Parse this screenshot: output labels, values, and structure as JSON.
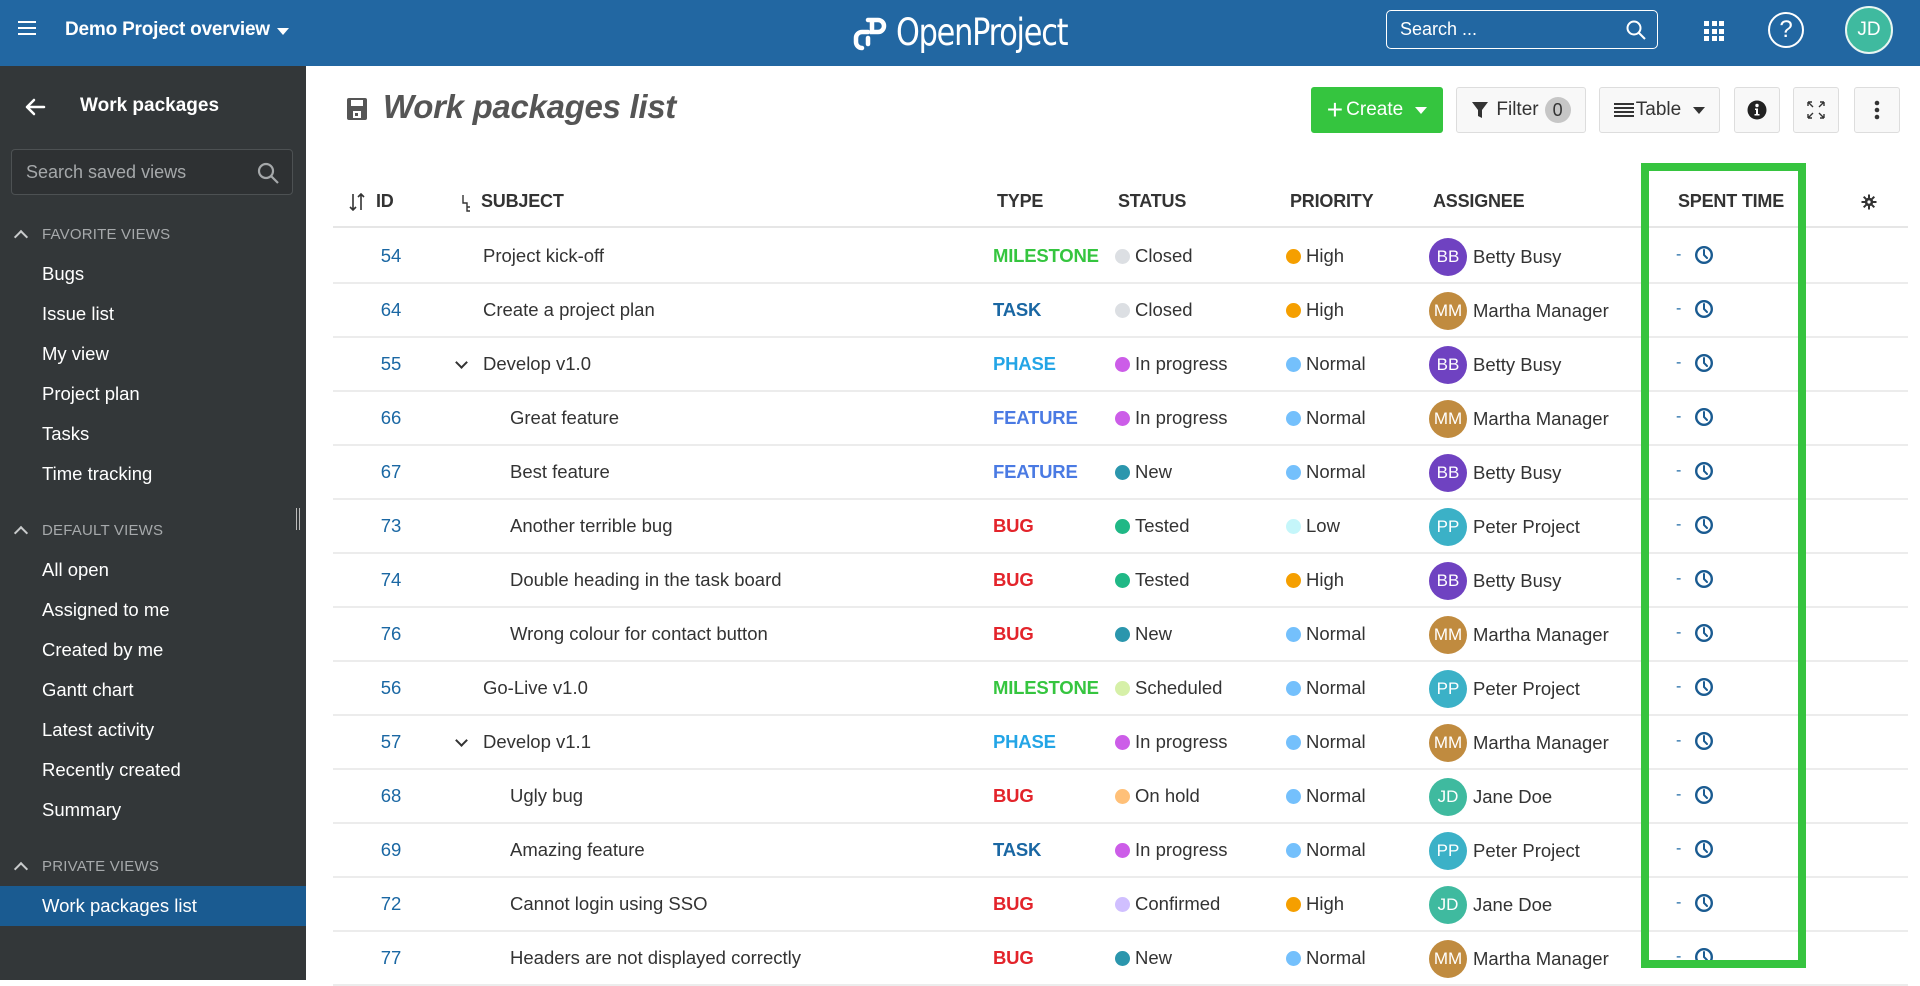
{
  "header": {
    "menu_icon": "hamburger-icon",
    "project_name": "Demo Project overview",
    "logo_text": "OpenProject",
    "search_placeholder": "Search ...",
    "modules_icon": "grid-icon",
    "help_icon_label": "?",
    "user_initials": "JD",
    "user_avatar_color": "#3fba9f",
    "brand_color": "#2267a2"
  },
  "sidebar": {
    "back_icon": "arrow-left-icon",
    "title": "Work packages",
    "search_placeholder": "Search saved views",
    "sections": [
      {
        "label": "FAVORITE VIEWS",
        "items": [
          "Bugs",
          "Issue list",
          "My view",
          "Project plan",
          "Tasks",
          "Time tracking"
        ]
      },
      {
        "label": "DEFAULT VIEWS",
        "items": [
          "All open",
          "Assigned to me",
          "Created by me",
          "Gantt chart",
          "Latest activity",
          "Recently created",
          "Summary"
        ]
      },
      {
        "label": "PRIVATE VIEWS",
        "items": [
          "Work packages list"
        ]
      }
    ],
    "active_item": "Work packages list"
  },
  "toolbar": {
    "title": "Work packages list",
    "create_label": "Create",
    "filter_label": "Filter",
    "filter_count": "0",
    "view_mode_label": "Table",
    "info_icon": "info-icon",
    "fullscreen_icon": "fullscreen-icon",
    "more_icon": "more-vertical-icon",
    "create_color": "#35c53f"
  },
  "table": {
    "columns": {
      "id": "ID",
      "subject": "SUBJECT",
      "type": "TYPE",
      "status": "STATUS",
      "priority": "PRIORITY",
      "assignee": "ASSIGNEE",
      "spent_time": "SPENT TIME"
    },
    "highlighted_column": "SPENT TIME",
    "highlight_color": "#36c43f",
    "type_colors": {
      "MILESTONE": "#35c53f",
      "TASK": "#1a67a3",
      "PHASE": "#23a5e6",
      "FEATURE": "#4a7ae3",
      "BUG": "#e3242b"
    },
    "status_colors": {
      "Closed": "#dcdfe3",
      "In progress": "#cc5de8",
      "New": "#2b96ad",
      "Tested": "#20b886",
      "Scheduled": "#d6f0a8",
      "On hold": "#ffc078",
      "Confirmed": "#d0bfff"
    },
    "priority_colors": {
      "High": "#f59f00",
      "Normal": "#74c0fc",
      "Low": "#c5f6fa"
    },
    "assignee_colors": {
      "Betty Busy": "#6f42c1",
      "Martha Manager": "#c08b3f",
      "Peter Project": "#3bb1c7",
      "Jane Doe": "#3fba9f"
    },
    "rows": [
      {
        "id": "54",
        "subject": "Project kick-off",
        "indent": 1,
        "expander": false,
        "type": "MILESTONE",
        "status": "Closed",
        "priority": "High",
        "assignee": "Betty Busy",
        "initials": "BB",
        "spent": "-"
      },
      {
        "id": "64",
        "subject": "Create a project plan",
        "indent": 1,
        "expander": false,
        "type": "TASK",
        "status": "Closed",
        "priority": "High",
        "assignee": "Martha Manager",
        "initials": "MM",
        "spent": "-"
      },
      {
        "id": "55",
        "subject": "Develop v1.0",
        "indent": 1,
        "expander": true,
        "type": "PHASE",
        "status": "In progress",
        "priority": "Normal",
        "assignee": "Betty Busy",
        "initials": "BB",
        "spent": "-"
      },
      {
        "id": "66",
        "subject": "Great feature",
        "indent": 2,
        "expander": false,
        "type": "FEATURE",
        "status": "In progress",
        "priority": "Normal",
        "assignee": "Martha Manager",
        "initials": "MM",
        "spent": "-"
      },
      {
        "id": "67",
        "subject": "Best feature",
        "indent": 2,
        "expander": false,
        "type": "FEATURE",
        "status": "New",
        "priority": "Normal",
        "assignee": "Betty Busy",
        "initials": "BB",
        "spent": "-"
      },
      {
        "id": "73",
        "subject": "Another terrible bug",
        "indent": 2,
        "expander": false,
        "type": "BUG",
        "status": "Tested",
        "priority": "Low",
        "assignee": "Peter Project",
        "initials": "PP",
        "spent": "-"
      },
      {
        "id": "74",
        "subject": "Double heading in the task board",
        "indent": 2,
        "expander": false,
        "type": "BUG",
        "status": "Tested",
        "priority": "High",
        "assignee": "Betty Busy",
        "initials": "BB",
        "spent": "-"
      },
      {
        "id": "76",
        "subject": "Wrong colour for contact button",
        "indent": 2,
        "expander": false,
        "type": "BUG",
        "status": "New",
        "priority": "Normal",
        "assignee": "Martha Manager",
        "initials": "MM",
        "spent": "-"
      },
      {
        "id": "56",
        "subject": "Go-Live v1.0",
        "indent": 1,
        "expander": false,
        "type": "MILESTONE",
        "status": "Scheduled",
        "priority": "Normal",
        "assignee": "Peter Project",
        "initials": "PP",
        "spent": "-"
      },
      {
        "id": "57",
        "subject": "Develop v1.1",
        "indent": 1,
        "expander": true,
        "type": "PHASE",
        "status": "In progress",
        "priority": "Normal",
        "assignee": "Martha Manager",
        "initials": "MM",
        "spent": "-"
      },
      {
        "id": "68",
        "subject": "Ugly bug",
        "indent": 2,
        "expander": false,
        "type": "BUG",
        "status": "On hold",
        "priority": "Normal",
        "assignee": "Jane Doe",
        "initials": "JD",
        "spent": "-"
      },
      {
        "id": "69",
        "subject": "Amazing feature",
        "indent": 2,
        "expander": false,
        "type": "TASK",
        "status": "In progress",
        "priority": "Normal",
        "assignee": "Peter Project",
        "initials": "PP",
        "spent": "-"
      },
      {
        "id": "72",
        "subject": "Cannot login using SSO",
        "indent": 2,
        "expander": false,
        "type": "BUG",
        "status": "Confirmed",
        "priority": "High",
        "assignee": "Jane Doe",
        "initials": "JD",
        "spent": "-"
      },
      {
        "id": "77",
        "subject": "Headers are not displayed correctly",
        "indent": 2,
        "expander": false,
        "type": "BUG",
        "status": "New",
        "priority": "Normal",
        "assignee": "Martha Manager",
        "initials": "MM",
        "spent": "-"
      }
    ]
  }
}
